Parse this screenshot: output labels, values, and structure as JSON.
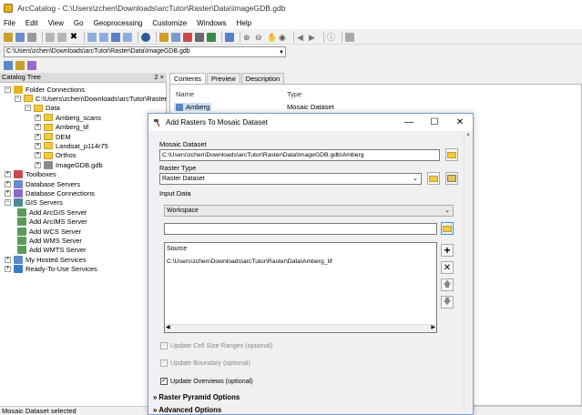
{
  "app": {
    "title": "ArcCatalog - C:\\Users\\zchen\\Downloads\\arcTutor\\Raster\\Data\\ImageGDB.gdb"
  },
  "menu": [
    "File",
    "Edit",
    "View",
    "Go",
    "Geoprocessing",
    "Customize",
    "Windows",
    "Help"
  ],
  "location": {
    "value": "C:\\Users\\zchen\\Downloads\\arcTutor\\Raster\\Data\\ImageGDB.gdb"
  },
  "tree": {
    "header": "Catalog Tree",
    "pin": "2 ×",
    "items": [
      {
        "label": "Folder Connections",
        "level": 0,
        "exp": "−",
        "icon": "folder-connections-icon"
      },
      {
        "label": "C:\\Users\\zchen\\Downloads\\arcTutor\\Raster",
        "level": 1,
        "exp": "−",
        "icon": "folder-icon"
      },
      {
        "label": "Data",
        "level": 2,
        "exp": "−",
        "icon": "folder-icon"
      },
      {
        "label": "Amberg_scans",
        "level": 3,
        "exp": "+",
        "icon": "folder-icon"
      },
      {
        "label": "Amberg_tif",
        "level": 3,
        "exp": "+",
        "icon": "folder-icon"
      },
      {
        "label": "DEM",
        "level": 3,
        "exp": "+",
        "icon": "folder-icon"
      },
      {
        "label": "Landsat_p114r75",
        "level": 3,
        "exp": "+",
        "icon": "folder-icon"
      },
      {
        "label": "Orthos",
        "level": 3,
        "exp": "+",
        "icon": "folder-icon"
      },
      {
        "label": "ImageGDB.gdb",
        "level": 3,
        "exp": "+",
        "icon": "geodatabase-icon"
      },
      {
        "label": "Toolboxes",
        "level": 0,
        "exp": "+",
        "icon": "toolbox-icon"
      },
      {
        "label": "Database Servers",
        "level": 0,
        "exp": "+",
        "icon": "database-servers-icon"
      },
      {
        "label": "Database Connections",
        "level": 0,
        "exp": "+",
        "icon": "database-connections-icon"
      },
      {
        "label": "GIS Servers",
        "level": 0,
        "exp": "−",
        "icon": "gis-servers-icon"
      },
      {
        "label": "Add ArcGIS Server",
        "level": 1,
        "exp": "",
        "icon": "add-server-icon"
      },
      {
        "label": "Add ArcIMS Server",
        "level": 1,
        "exp": "",
        "icon": "add-server-icon"
      },
      {
        "label": "Add WCS Server",
        "level": 1,
        "exp": "",
        "icon": "add-server-icon"
      },
      {
        "label": "Add WMS Server",
        "level": 1,
        "exp": "",
        "icon": "add-server-icon"
      },
      {
        "label": "Add WMTS Server",
        "level": 1,
        "exp": "",
        "icon": "add-server-icon"
      },
      {
        "label": "My Hosted Services",
        "level": 0,
        "exp": "+",
        "icon": "hosted-services-icon"
      },
      {
        "label": "Ready-To-Use Services",
        "level": 0,
        "exp": "+",
        "icon": "ready-services-icon"
      }
    ]
  },
  "tabs": [
    {
      "label": "Contents",
      "active": true
    },
    {
      "label": "Preview",
      "active": false
    },
    {
      "label": "Description",
      "active": false
    }
  ],
  "contents": {
    "col_name": "Name",
    "col_type": "Type",
    "row": {
      "name": "Amberg",
      "type": "Mosaic Dataset"
    }
  },
  "dialog": {
    "title": "Add Rasters To Mosaic Dataset",
    "mosaic_label": "Mosaic Dataset",
    "mosaic_value": "C:\\Users\\zchen\\Downloads\\arcTutor\\Raster\\Data\\ImageGDB.gdb\\Amberg",
    "raster_type_label": "Raster Type",
    "raster_type_value": "Raster Dataset",
    "input_data_label": "Input Data",
    "input_data_value": "Workspace",
    "source_header": "Source",
    "source_item": "C:\\Users\\zchen\\Downloads\\arcTutor\\Raster\\Data\\Amberg_tif",
    "cb_cell_size": "Update Cell Size Ranges (optional)",
    "cb_boundary": "Update Boundary (optional)",
    "cb_overviews": "Update Overviews (optional)",
    "sect_pyramid": "Raster Pyramid Options",
    "sect_advanced": "Advanced Options"
  },
  "status": {
    "text": "Mosaic Dataset selected"
  }
}
